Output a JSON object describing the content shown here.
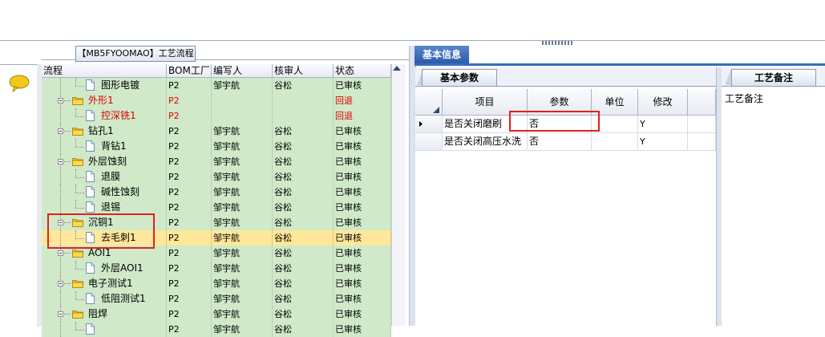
{
  "process_panel": {
    "title": "【MB5FYOOMAO】工艺流程",
    "columns": [
      "流程",
      "BOM工厂",
      "编写人",
      "核审人",
      "状态"
    ],
    "rows": [
      {
        "name": "图形电镀",
        "level": 2,
        "type": "doc",
        "bom": "P2",
        "writer": "邹宇航",
        "reviewer": "谷松",
        "status": "已审核",
        "red": false,
        "selected": false
      },
      {
        "name": "外形1",
        "level": 1,
        "type": "folder",
        "bom": "P2",
        "writer": "",
        "reviewer": "",
        "status": "回退",
        "red": true,
        "selected": false
      },
      {
        "name": "控深铣1",
        "level": 2,
        "type": "doc",
        "bom": "P2",
        "writer": "",
        "reviewer": "",
        "status": "回退",
        "red": true,
        "selected": false
      },
      {
        "name": "钻孔1",
        "level": 1,
        "type": "folder",
        "bom": "P2",
        "writer": "邹宇航",
        "reviewer": "谷松",
        "status": "已审核",
        "red": false,
        "selected": false
      },
      {
        "name": "背钻1",
        "level": 2,
        "type": "doc",
        "bom": "P2",
        "writer": "邹宇航",
        "reviewer": "谷松",
        "status": "已审核",
        "red": false,
        "selected": false
      },
      {
        "name": "外层蚀刻",
        "level": 1,
        "type": "folder",
        "bom": "P2",
        "writer": "邹宇航",
        "reviewer": "谷松",
        "status": "已审核",
        "red": false,
        "selected": false
      },
      {
        "name": "退膜",
        "level": 2,
        "type": "doc",
        "bom": "P2",
        "writer": "邹宇航",
        "reviewer": "谷松",
        "status": "已审核",
        "red": false,
        "selected": false
      },
      {
        "name": "碱性蚀刻",
        "level": 2,
        "type": "doc",
        "bom": "P2",
        "writer": "邹宇航",
        "reviewer": "谷松",
        "status": "已审核",
        "red": false,
        "selected": false
      },
      {
        "name": "退锡",
        "level": 2,
        "type": "doc",
        "bom": "P2",
        "writer": "邹宇航",
        "reviewer": "谷松",
        "status": "已审核",
        "red": false,
        "selected": false
      },
      {
        "name": "沉铜1",
        "level": 1,
        "type": "folder",
        "bom": "P2",
        "writer": "邹宇航",
        "reviewer": "谷松",
        "status": "已审核",
        "red": false,
        "selected": false
      },
      {
        "name": "去毛刺1",
        "level": 2,
        "type": "doc",
        "bom": "P2",
        "writer": "邹宇航",
        "reviewer": "谷松",
        "status": "已审核",
        "red": false,
        "selected": true
      },
      {
        "name": "AOI1",
        "level": 1,
        "type": "folder",
        "bom": "P2",
        "writer": "邹宇航",
        "reviewer": "谷松",
        "status": "已审核",
        "red": false,
        "selected": false
      },
      {
        "name": "外层AOI1",
        "level": 2,
        "type": "doc",
        "bom": "P2",
        "writer": "邹宇航",
        "reviewer": "谷松",
        "status": "已审核",
        "red": false,
        "selected": false
      },
      {
        "name": "电子测试1",
        "level": 1,
        "type": "folder",
        "bom": "P2",
        "writer": "邹宇航",
        "reviewer": "谷松",
        "status": "已审核",
        "red": false,
        "selected": false
      },
      {
        "name": "低阻测试1",
        "level": 2,
        "type": "doc",
        "bom": "P2",
        "writer": "邹宇航",
        "reviewer": "谷松",
        "status": "已审核",
        "red": false,
        "selected": false
      },
      {
        "name": "阻焊",
        "level": 1,
        "type": "folder",
        "bom": "P2",
        "writer": "邹宇航",
        "reviewer": "谷松",
        "status": "已审核",
        "red": false,
        "selected": false
      },
      {
        "name": "",
        "level": 2,
        "type": "doc",
        "bom": "P2",
        "writer": "邹宇航",
        "reviewer": "谷松",
        "status": "已审核",
        "red": false,
        "selected": false
      }
    ]
  },
  "info_panel": {
    "tab": "基本信息",
    "params_tab": "基本参数",
    "columns": [
      "项目",
      "参数",
      "单位",
      "修改"
    ],
    "rows": [
      {
        "item": "是否关闭磨刷",
        "param": "否",
        "unit": "",
        "modify": "Y",
        "current": true
      },
      {
        "item": "是否关闭高压水洗",
        "param": "否",
        "unit": "",
        "modify": "Y",
        "current": false
      }
    ]
  },
  "notes_panel": {
    "tab": "工艺备注",
    "label": "工艺备注"
  },
  "colors": {
    "row_bg": "#cfe9c9",
    "selected_row_bg": "#ffe79b",
    "tab_active": "#2a5aa8",
    "highlight_box": "#e02020",
    "return_status": "#e00000"
  }
}
